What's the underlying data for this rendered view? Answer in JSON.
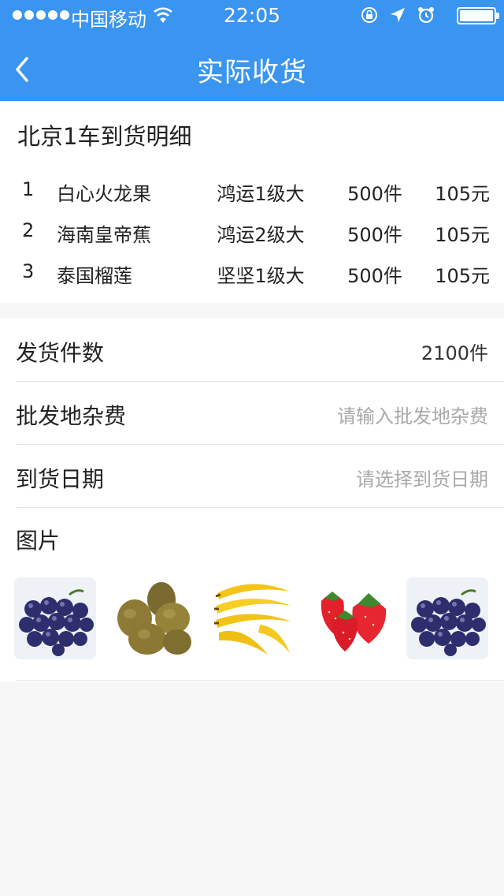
{
  "status_bar": {
    "carrier": "中国移动",
    "time": "22:05"
  },
  "nav": {
    "title": "实际收货"
  },
  "arrival_detail": {
    "title": "北京1车到货明细",
    "items": [
      {
        "index": "1",
        "name": "白心火龙果",
        "grade": "鸿运1级大",
        "quantity": "500件",
        "price": "105元"
      },
      {
        "index": "2",
        "name": "海南皇帝蕉",
        "grade": "鸿运2级大",
        "quantity": "500件",
        "price": "105元"
      },
      {
        "index": "3",
        "name": "泰国榴莲",
        "grade": "坚坚1级大",
        "quantity": "500件",
        "price": "105元"
      }
    ]
  },
  "form": {
    "shipped_count": {
      "label": "发货件数",
      "value": "2100件"
    },
    "wholesale_fee": {
      "label": "批发地杂费",
      "placeholder": "请输入批发地杂费"
    },
    "arrival_date": {
      "label": "到货日期",
      "placeholder": "请选择到货日期"
    },
    "pictures": {
      "label": "图片",
      "items": [
        "grapes",
        "kiwi",
        "bananas",
        "strawberries",
        "grapes"
      ]
    }
  },
  "colors": {
    "primary": "#3a95f0",
    "placeholder": "#a9a9a9"
  }
}
